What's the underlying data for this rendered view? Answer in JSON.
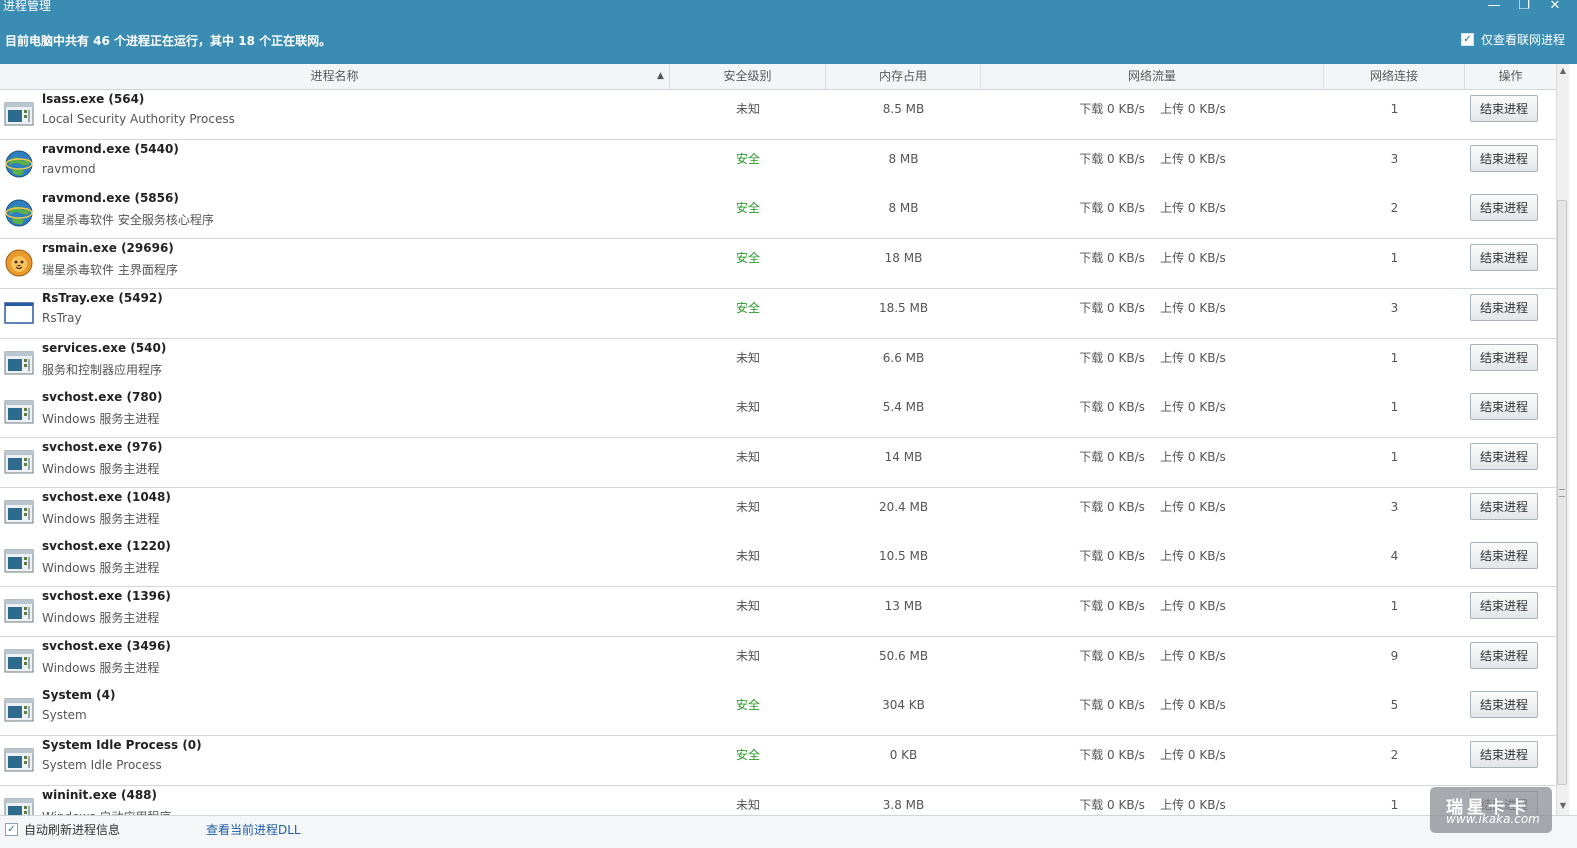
{
  "window": {
    "title": "进程管理",
    "minimize_glyph": "—",
    "restore_glyph": "❐",
    "close_glyph": "✕"
  },
  "summary_text": "目前电脑中共有 46 个进程正在运行，其中 18 个正在联网。",
  "online_filter": {
    "label": "仅查看联网进程",
    "checked": true
  },
  "columns": {
    "name": "进程名称",
    "security": "安全级别",
    "memory": "内存占用",
    "traffic": "网络流量",
    "connections": "网络连接",
    "action": "操作"
  },
  "colors": {
    "title_bar": "#3a8cb3",
    "safe": "#2a9a2a",
    "link": "#1f5ea8"
  },
  "processes": [
    {
      "name": "lsass.exe (564)",
      "desc": "Local Security Authority Process",
      "icon": "window-app-icon",
      "security": "未知",
      "memory": "8.5 MB",
      "traffic": "下载 0 KB/s    上传 0 KB/s",
      "connections": "1",
      "action": "结束进程"
    },
    {
      "name": "ravmond.exe (5440)",
      "desc": "ravmond",
      "icon": "globe-shield-icon",
      "security": "安全",
      "memory": "8 MB",
      "traffic": "下载 0 KB/s    上传 0 KB/s",
      "connections": "3",
      "action": "结束进程"
    },
    {
      "name": "ravmond.exe (5856)",
      "desc": "瑞星杀毒软件 安全服务核心程序",
      "icon": "globe-shield-icon",
      "security": "安全",
      "memory": "8 MB",
      "traffic": "下载 0 KB/s    上传 0 KB/s",
      "connections": "2",
      "action": "结束进程"
    },
    {
      "name": "rsmain.exe (29696)",
      "desc": "瑞星杀毒软件 主界面程序",
      "icon": "lion-icon",
      "security": "安全",
      "memory": "18 MB",
      "traffic": "下载 0 KB/s    上传 0 KB/s",
      "connections": "1",
      "action": "结束进程"
    },
    {
      "name": "RsTray.exe (5492)",
      "desc": "RsTray",
      "icon": "blank-window-icon",
      "security": "安全",
      "memory": "18.5 MB",
      "traffic": "下载 0 KB/s    上传 0 KB/s",
      "connections": "3",
      "action": "结束进程"
    },
    {
      "name": "services.exe (540)",
      "desc": "服务和控制器应用程序",
      "icon": "window-app-icon",
      "security": "未知",
      "memory": "6.6 MB",
      "traffic": "下载 0 KB/s    上传 0 KB/s",
      "connections": "1",
      "action": "结束进程"
    },
    {
      "name": "svchost.exe (780)",
      "desc": "Windows 服务主进程",
      "icon": "window-app-icon",
      "security": "未知",
      "memory": "5.4 MB",
      "traffic": "下载 0 KB/s    上传 0 KB/s",
      "connections": "1",
      "action": "结束进程"
    },
    {
      "name": "svchost.exe (976)",
      "desc": "Windows 服务主进程",
      "icon": "window-app-icon",
      "security": "未知",
      "memory": "14 MB",
      "traffic": "下载 0 KB/s    上传 0 KB/s",
      "connections": "1",
      "action": "结束进程"
    },
    {
      "name": "svchost.exe (1048)",
      "desc": "Windows 服务主进程",
      "icon": "window-app-icon",
      "security": "未知",
      "memory": "20.4 MB",
      "traffic": "下载 0 KB/s    上传 0 KB/s",
      "connections": "3",
      "action": "结束进程"
    },
    {
      "name": "svchost.exe (1220)",
      "desc": "Windows 服务主进程",
      "icon": "window-app-icon",
      "security": "未知",
      "memory": "10.5 MB",
      "traffic": "下载 0 KB/s    上传 0 KB/s",
      "connections": "4",
      "action": "结束进程"
    },
    {
      "name": "svchost.exe (1396)",
      "desc": "Windows 服务主进程",
      "icon": "window-app-icon",
      "security": "未知",
      "memory": "13 MB",
      "traffic": "下载 0 KB/s    上传 0 KB/s",
      "connections": "1",
      "action": "结束进程"
    },
    {
      "name": "svchost.exe (3496)",
      "desc": "Windows 服务主进程",
      "icon": "window-app-icon",
      "security": "未知",
      "memory": "50.6 MB",
      "traffic": "下载 0 KB/s    上传 0 KB/s",
      "connections": "9",
      "action": "结束进程"
    },
    {
      "name": "System (4)",
      "desc": "System",
      "icon": "window-app-icon",
      "security": "安全",
      "memory": "304 KB",
      "traffic": "下载 0 KB/s    上传 0 KB/s",
      "connections": "5",
      "action": "结束进程"
    },
    {
      "name": "System Idle Process (0)",
      "desc": "System Idle Process",
      "icon": "window-app-icon",
      "security": "安全",
      "memory": "0 KB",
      "traffic": "下载 0 KB/s    上传 0 KB/s",
      "connections": "2",
      "action": "结束进程"
    },
    {
      "name": "wininit.exe (488)",
      "desc": "Windows 启动应用程序",
      "icon": "window-app-icon",
      "security": "未知",
      "memory": "3.8 MB",
      "traffic": "下载 0 KB/s    上传 0 KB/s",
      "connections": "1",
      "action": "结束进程"
    }
  ],
  "footer": {
    "auto_refresh": {
      "label": "自动刷新进程信息",
      "checked": true
    },
    "dll_link": "查看当前进程DLL"
  },
  "watermark": {
    "top": "瑞星卡卡",
    "bottom": "www.ikaka.com"
  }
}
